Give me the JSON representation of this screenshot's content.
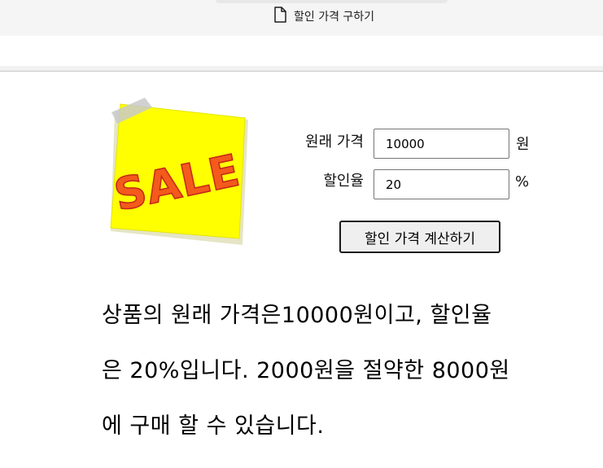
{
  "browser": {
    "tab_title": "할인 가격 구하기",
    "tab_icon": "document-icon"
  },
  "hero": {
    "image_icon": "sale-sticky-note-icon",
    "image_text": "SALE",
    "note_color": "#ffff00",
    "text_color": "#e23b1a"
  },
  "form": {
    "price_label": "원래 가격",
    "price_value": "10000",
    "price_unit": "원",
    "rate_label": "할인율",
    "rate_value": "20",
    "rate_unit": "%",
    "calculate_label": "할인 가격 계산하기"
  },
  "result": {
    "lines": [
      "상품의 원래 가격은10000원이고, 할인율",
      "은 20%입니다. 2000원을 절약한 8000원",
      "에 구매 할 수 있습니다."
    ]
  }
}
